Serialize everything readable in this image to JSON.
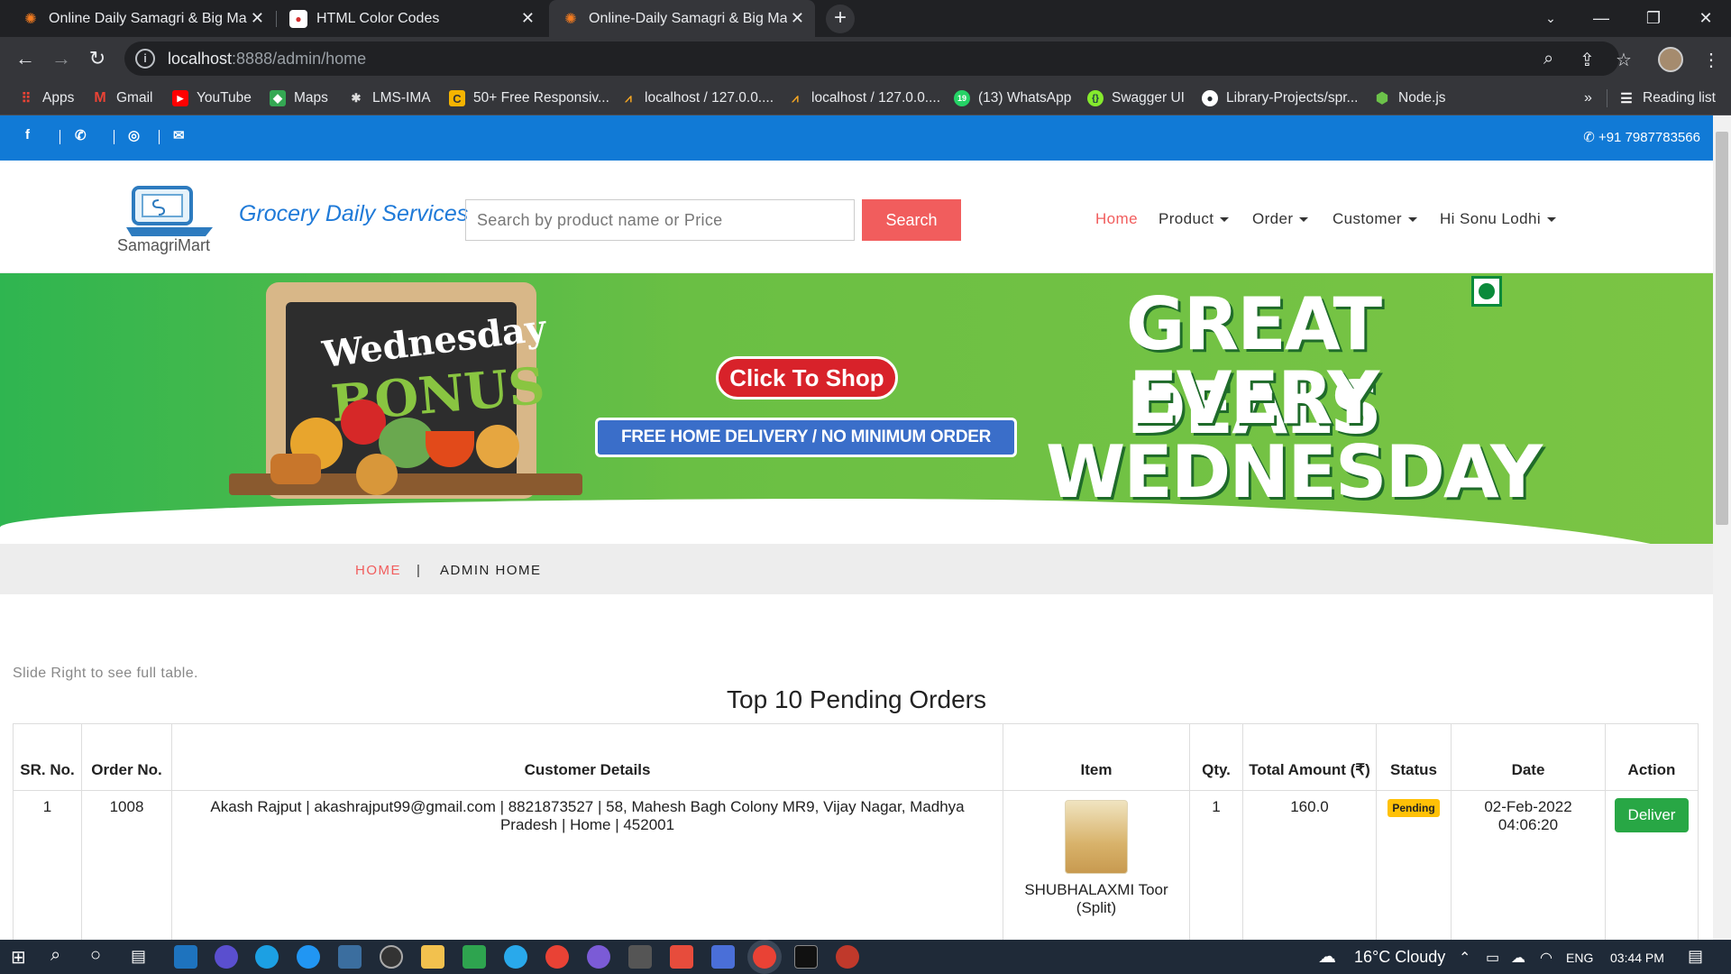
{
  "browser": {
    "tabs": [
      {
        "title": "Online Daily Samagri & Big Mark",
        "active": false
      },
      {
        "title": "HTML Color Codes",
        "active": false
      },
      {
        "title": "Online-Daily Samagri & Big Mark",
        "active": true
      }
    ],
    "url_host": "localhost",
    "url_path": ":8888/admin/home",
    "bookmarks": [
      "Apps",
      "Gmail",
      "YouTube",
      "Maps",
      "LMS-IMA",
      "50+ Free Responsiv...",
      "localhost / 127.0.0....",
      "localhost / 127.0.0....",
      "(13) WhatsApp",
      "Swagger UI",
      "Library-Projects/spr...",
      "Node.js"
    ],
    "reading_list": "Reading list",
    "more": "»"
  },
  "topbar": {
    "phone": "+91 7987783566"
  },
  "header": {
    "logo_name": "SamagriMart",
    "brand": "Grocery Daily Services",
    "search_placeholder": "Search by product name or Price",
    "search_button": "Search",
    "nav": {
      "home": "Home",
      "product": "Product",
      "order": "Order",
      "customer": "Customer",
      "user": "Hi Sonu Lodhi"
    }
  },
  "banner": {
    "board_line1": "Wednesday",
    "board_line2": "BONUS",
    "cta": "Click To Shop",
    "delivery": "FREE HOME DELIVERY / NO MINIMUM ORDER",
    "deal_line1": "GREAT DEALS",
    "deal_line2": "EVERY",
    "deal_line3": "WEDNESDAY"
  },
  "breadcrumb": {
    "home": "HOME",
    "separator": "|",
    "current": "ADMIN HOME"
  },
  "main": {
    "slide_hint": "Slide Right to see full table.",
    "table_title": "Top 10 Pending Orders",
    "columns": [
      "SR. No.",
      "Order No.",
      "Customer Details",
      "Item",
      "Qty.",
      "Total Amount (₹)",
      "Status",
      "Date",
      "Action"
    ],
    "rows": [
      {
        "sr": "1",
        "order_no": "1008",
        "customer": "Akash Rajput | akashrajput99@gmail.com | 8821873527 | 58, Mahesh Bagh Colony MR9, Vijay Nagar, Madhya Pradesh | Home | 452001",
        "item": "SHUBHALAXMI Toor (Split)",
        "qty": "1",
        "total": "160.0",
        "status": "Pending",
        "date": "02-Feb-2022 04:06:20",
        "action": "Deliver"
      }
    ]
  },
  "taskbar": {
    "weather": "16°C  Cloudy",
    "lang": "ENG",
    "time": "03:44 PM"
  },
  "colors": {
    "accent": "#f15d5d",
    "topbar": "#117ad6",
    "brand": "#1f7ad8",
    "deliver": "#28a745",
    "badge": "#ffc107"
  }
}
